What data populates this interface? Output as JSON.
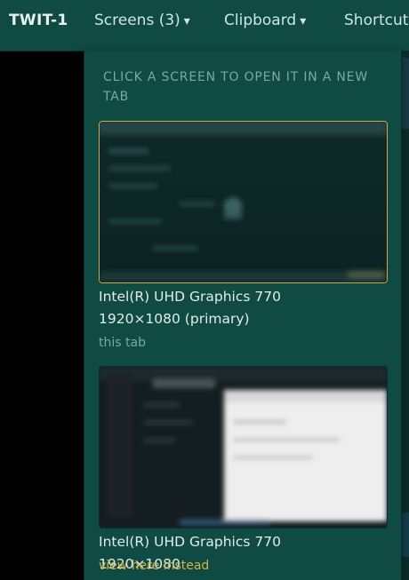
{
  "topbar": {
    "brand": "TWIT-1",
    "screens_label": "Screens (3)",
    "clipboard_label": "Clipboard",
    "shortcuts_label": "Shortcuts",
    "caret": "▾"
  },
  "dropdown": {
    "hint": "CLICK A SCREEN TO OPEN IT IN A NEW TAB",
    "screens": [
      {
        "name": "Intel(R) UHD Graphics 770 1920×1080 (primary)",
        "status": "this tab"
      },
      {
        "name": "Intel(R) UHD Graphics 770 1920×1080",
        "status": "view here instead"
      }
    ]
  },
  "colors": {
    "topbar_bg": "#0f4a43",
    "panel_bg": "#0f4a43",
    "selected_border": "#c9a845",
    "link": "#d6b24a",
    "muted": "#7ea7a0"
  }
}
